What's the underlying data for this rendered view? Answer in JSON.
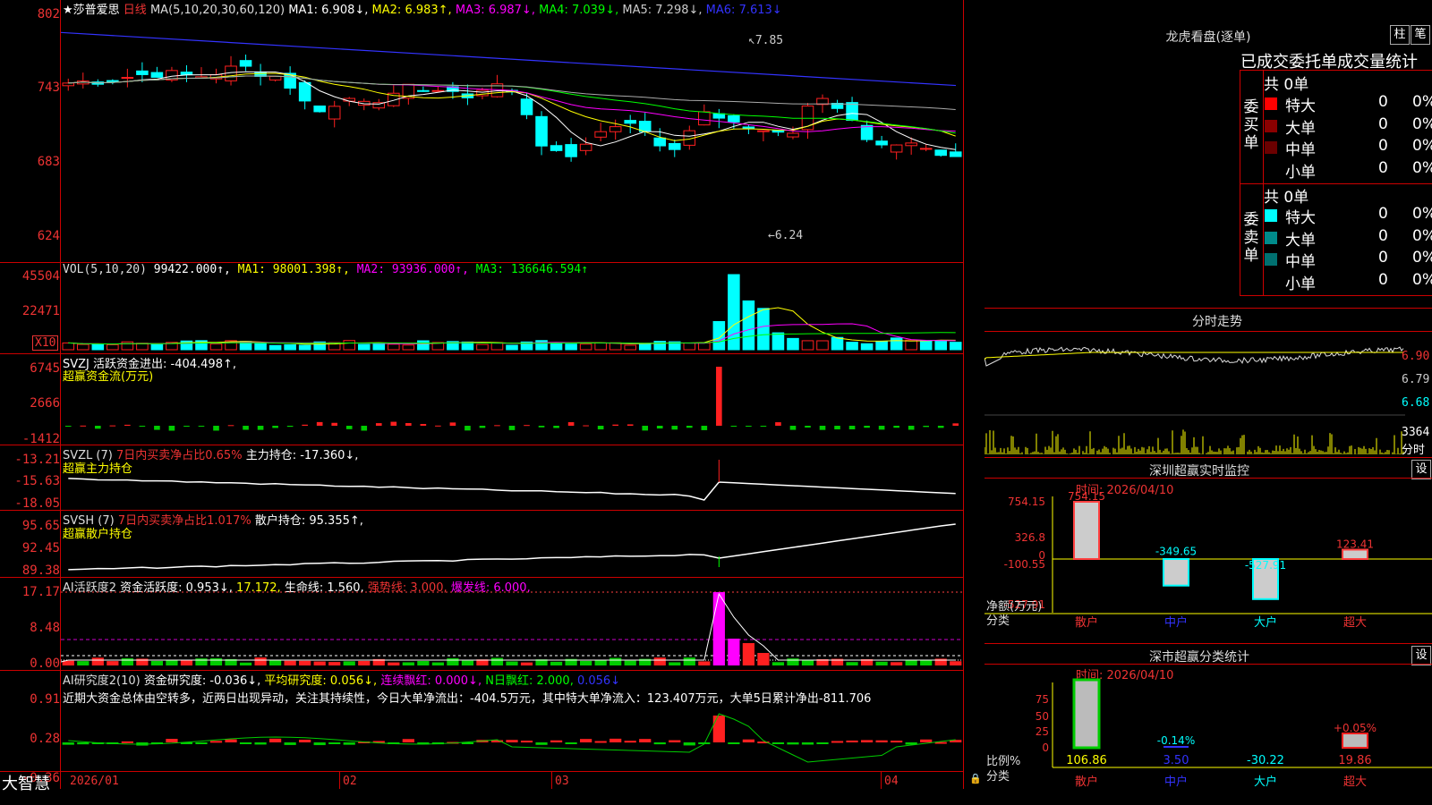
{
  "stock": {
    "title": "★莎普爱思",
    "period": "日线"
  },
  "main_legend": {
    "ma_label": "MA(5,10,20,30,60,120)",
    "ma1": "MA1: 6.908↓,",
    "ma2": "MA2: 6.983↑,",
    "ma3": "MA3: 6.987↓,",
    "ma4": "MA4: 7.039↓,",
    "ma5": "MA5: 7.298↓,",
    "ma6": "MA6: 7.613↓"
  },
  "price_axis": [
    "802",
    "743",
    "683",
    "624"
  ],
  "price_annotations": {
    "high": "7.85",
    "low": "6.24"
  },
  "vol": {
    "legend": "VOL(5,10,20)",
    "value": "99422.000↑,",
    "ma1": "MA1: 98001.398↑,",
    "ma2": "MA2: 93936.000↑,",
    "ma3": "MA3: 136646.594↑",
    "axis": [
      "45504",
      "22471"
    ],
    "unit": "X10"
  },
  "svzj": {
    "legend": "SVZJ  活跃资金进出: -404.498↑,",
    "sub": "超赢资金流(万元)",
    "axis": [
      "6745",
      "2666",
      "-1412"
    ]
  },
  "svzl": {
    "legend": "SVZL (7)",
    "ratio": "7日内买卖净占比0.65%",
    "hold": "主力持仓: -17.360↓,",
    "sub": "超赢主力持仓",
    "axis": [
      "-13.21",
      "-15.63",
      "-18.05"
    ]
  },
  "svsh": {
    "legend": "SVSH (7)",
    "ratio": "7日内买卖净占比1.017%",
    "hold": "散户持仓: 95.355↑,",
    "sub": "超赢散户持仓",
    "axis": [
      "95.65",
      "92.45",
      "89.38"
    ]
  },
  "ai1": {
    "legend": "AI活跃度2",
    "v1": "资金活跃度: 0.953↓,",
    "v2": "17.172,",
    "v3": "生命线: 1.560,",
    "v4": "强势线: 3.000,",
    "v5": "爆发线: 6.000,",
    "axis": [
      "17.17",
      "8.48",
      "0.00"
    ]
  },
  "ai2": {
    "legend": "AI研究度2(10)",
    "v1": "资金研究度: -0.036↓,",
    "v2": "平均研究度: 0.056↓,",
    "v3": "连续飘红: 0.000↓,",
    "v4": "N日飘红: 2.000,",
    "v5": "0.056↓",
    "comment": "近期大资金总体由空转多，近两日出现异动，关注其持续性，今日大单净流出：-404.5万元，其中特大单净流入：123.407万元，大单5日累计净出-811.706",
    "axis": [
      "0.91",
      "0.28",
      "-0.36"
    ]
  },
  "date_axis": [
    "2026/01",
    "02",
    "03",
    "04"
  ],
  "brand": "大智慧",
  "right": {
    "dragon_title": "龙虎看盘(逐单)",
    "btn_bar": "柱",
    "btn_stroke": "笔",
    "stats_title": "已成交委托单成交量统计",
    "buy": {
      "side": "委买单",
      "total": "共 0单",
      "rows": [
        {
          "label": "特大",
          "count": "0",
          "pct": "0%",
          "color": "#ff0000"
        },
        {
          "label": "大单",
          "count": "0",
          "pct": "0%",
          "color": "#8b0000"
        },
        {
          "label": "中单",
          "count": "0",
          "pct": "0%",
          "color": "#6b0000"
        },
        {
          "label": "小单",
          "count": "0",
          "pct": "0%",
          "color": ""
        }
      ]
    },
    "sell": {
      "side": "委卖单",
      "total": "共 0单",
      "rows": [
        {
          "label": "特大",
          "count": "0",
          "pct": "0%",
          "color": "#00ffff"
        },
        {
          "label": "大单",
          "count": "0",
          "pct": "0%",
          "color": "#008b8b"
        },
        {
          "label": "中单",
          "count": "0",
          "pct": "0%",
          "color": "#007070"
        },
        {
          "label": "小单",
          "count": "0",
          "pct": "0%",
          "color": ""
        }
      ]
    },
    "intraday": {
      "title": "分时走势",
      "axis": [
        "6.90",
        "6.79",
        "6.68"
      ],
      "vol": "3364",
      "vol_label": "分时"
    },
    "monitor": {
      "title": "深圳超赢实时监控",
      "btn": "设",
      "time": "时间: 2026/04/10",
      "axis": [
        "754.15",
        "326.8",
        "0",
        "-100.55",
        "-527.91"
      ],
      "ylabel": "净额(万元)",
      "xlabel": "分类",
      "cats": [
        "散户",
        "中户",
        "大户",
        "超大"
      ],
      "values": [
        "754.15",
        "-349.65",
        "-527.91",
        "123.41"
      ]
    },
    "classify": {
      "title": "深市超赢分类统计",
      "btn": "设",
      "time": "时间: 2026/04/10",
      "axis": [
        "75",
        "50",
        "25",
        "0"
      ],
      "ylabel": "比例%",
      "xlabel": "分类",
      "cats": [
        "散户",
        "中户",
        "大户",
        "超大"
      ],
      "bottom": [
        "106.86",
        "3.50",
        "-30.22",
        "19.86"
      ],
      "labels": [
        "",
        "-0.14%",
        "",
        "+0.05%"
      ]
    }
  }
}
